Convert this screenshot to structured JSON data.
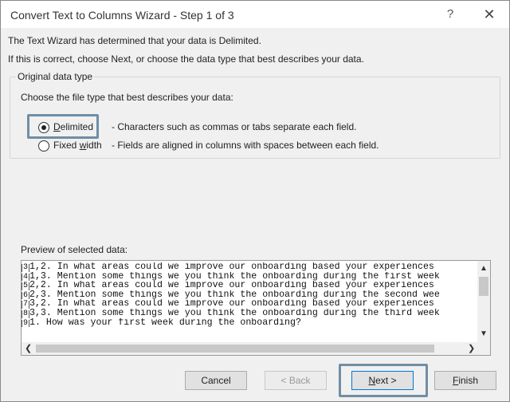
{
  "window": {
    "title": "Convert Text to Columns Wizard - Step 1 of 3",
    "help_label": "?",
    "close_label": "✕"
  },
  "info": {
    "line1": "The Text Wizard has determined that your data is Delimited.",
    "line2": "If this is correct, choose Next, or choose the data type that best describes your data."
  },
  "group": {
    "title": "Original data type",
    "prompt": "Choose the file type that best describes your data:",
    "options": [
      {
        "label": "Delimited",
        "mnemonic": "D",
        "description": "- Characters such as commas or tabs separate each field.",
        "selected": true
      },
      {
        "label": "Fixed width",
        "mnemonic": "w",
        "description": "- Fields are aligned in columns with spaces between each field.",
        "selected": false
      }
    ]
  },
  "preview": {
    "label": "Preview of selected data:",
    "lines": [
      {
        "num": "3",
        "text": "1,2. In what areas could we improve our onboarding based your experiences"
      },
      {
        "num": "4",
        "text": "1,3. Mention some things we you think the onboarding during the first week"
      },
      {
        "num": "5",
        "text": "2,2. In what areas could we improve our onboarding based your experiences"
      },
      {
        "num": "6",
        "text": "2,3. Mention some things we you think the onboarding during the second wee"
      },
      {
        "num": "7",
        "text": "3,2. In what areas could we improve our onboarding based your experiences"
      },
      {
        "num": "8",
        "text": "3,3. Mention some things we you think the onboarding during the third week"
      },
      {
        "num": "9",
        "text": "1. How was your first week during the onboarding?"
      }
    ]
  },
  "buttons": {
    "cancel": "Cancel",
    "back": "< Back",
    "next": "Next >",
    "finish": "Finish"
  }
}
